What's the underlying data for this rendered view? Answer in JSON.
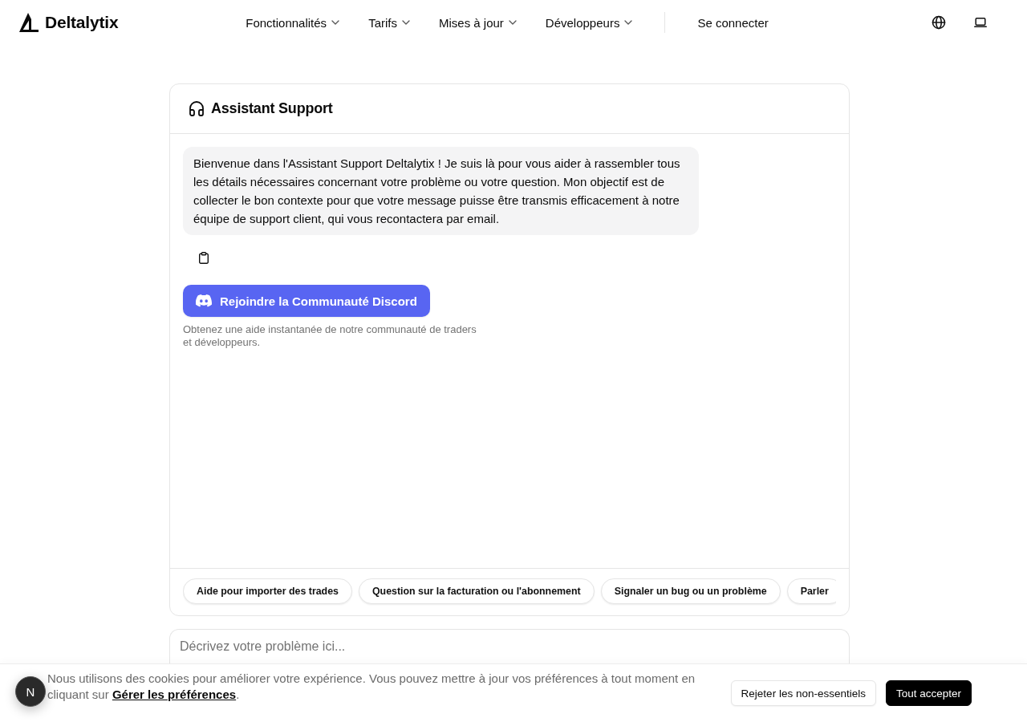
{
  "header": {
    "brand": "Deltalytix",
    "nav": [
      {
        "label": "Fonctionnalités"
      },
      {
        "label": "Tarifs"
      },
      {
        "label": "Mises à jour"
      },
      {
        "label": "Développeurs"
      }
    ],
    "sign_in": "Se connecter"
  },
  "chat": {
    "title": "Assistant Support",
    "messages": [
      {
        "kind": "assistant",
        "text": "Bienvenue dans l'Assistant Support Deltalytix ! Je suis là pour vous aider à rassembler tous les détails nécessaires concernant votre problème ou votre question. Mon objectif est de collecter le bon contexte pour que votre message puisse être transmis efficacement à notre équipe de support client, qui vous recontactera par email."
      }
    ],
    "discord": {
      "label": "Rejoindre la Communauté Discord",
      "caption": "Obtenez une aide instantanée de notre communauté de traders et développeurs."
    },
    "suggestions": [
      "Aide pour importer des trades",
      "Question sur la facturation ou l'abonnement",
      "Signaler un bug ou un problème",
      "Parler"
    ]
  },
  "composer": {
    "placeholder": "Décrivez votre problème ici..."
  },
  "cookie_banner": {
    "text": "Nous utilisons des cookies pour améliorer votre expérience. Vous pouvez mettre à jour vos préférences à tout moment en cliquant sur ",
    "link": "Gérer les préférences",
    "text_after": ".",
    "buttons": [
      {
        "label": "Rejeter les non-essentiels",
        "kind": "secondary"
      },
      {
        "label": "Tout accepter",
        "kind": "primary"
      }
    ]
  },
  "floating_badge": {
    "label": "N"
  }
}
